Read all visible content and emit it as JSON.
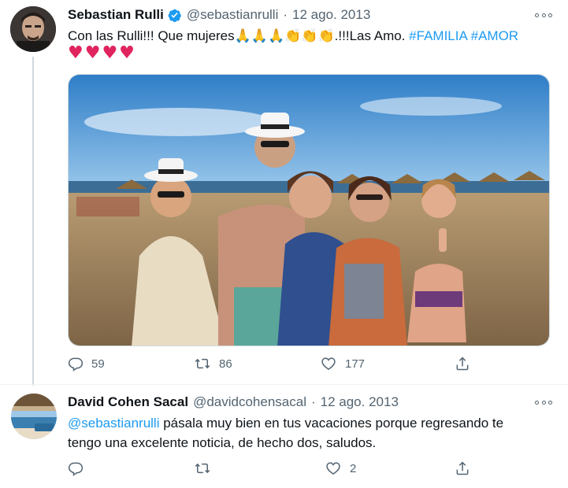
{
  "tweet": {
    "author_name": "Sebastian Rulli",
    "author_handle": "@sebastianrulli",
    "separator": "·",
    "date": "12 ago. 2013",
    "text_start": "Con las Rulli!!! Que mujeres",
    "hands_emoji": "🙏🙏🙏",
    "clap_emoji": "👏👏👏",
    "text_mid": ".!!!Las Amo. ",
    "hashtag_1": "#FAMILIA",
    "hashtag_2": "#AMOR",
    "hearts": "♥♥♥♥",
    "replies": "59",
    "retweets": "86",
    "likes": "177",
    "verified": true
  },
  "reply": {
    "author_name": "David Cohen Sacal",
    "author_handle": "@davidcohensacal",
    "separator": "·",
    "date": "12 ago. 2013",
    "mention": "@sebastianrulli",
    "text_line1": " pásala muy bien en tus vacaciones porque regresando te",
    "text_line2": "tengo una excelente noticia, de hecho dos, saludos.",
    "replies": "",
    "retweets": "",
    "likes": "2"
  },
  "colors": {
    "accent": "#1d9bf0",
    "muted": "#536471",
    "text": "#0f1419",
    "heart": "#e0245e"
  },
  "icons": [
    "verified-badge-icon",
    "more-icon",
    "reply-icon",
    "retweet-icon",
    "like-icon",
    "share-icon"
  ]
}
